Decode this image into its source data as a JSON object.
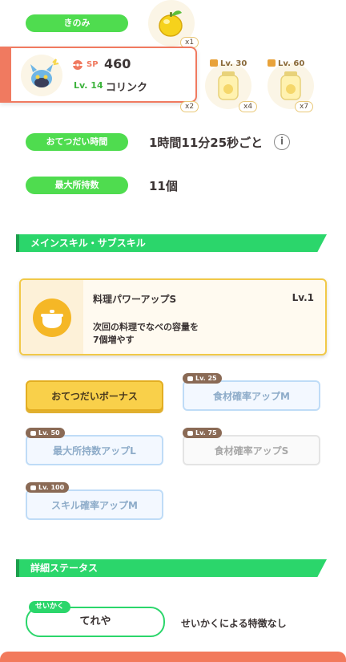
{
  "berry": {
    "label": "きのみ",
    "icon": "lemon-berry-icon",
    "qty": "x1"
  },
  "pokemon": {
    "sp_label": "SP",
    "sp_value": "460",
    "level": "Lv. 14",
    "name": "コリンク",
    "qty": "x2"
  },
  "ingredients": [
    {
      "level": "Lv. 30",
      "qty": "x4",
      "icon": "honey-jar-icon"
    },
    {
      "level": "Lv. 60",
      "qty": "x7",
      "icon": "honey-jar-icon"
    }
  ],
  "help_time": {
    "label": "おてつだい時間",
    "value": "1時間11分25秒ごと"
  },
  "max_carry": {
    "label": "最大所持数",
    "value": "11個"
  },
  "skills_section": {
    "title": "メインスキル・サブスキル"
  },
  "main_skill": {
    "name": "料理パワーアップS",
    "level": "Lv.1",
    "desc_line1": "次回の料理でなべの容量を",
    "desc_line2": "7個増やす"
  },
  "sub_skills": [
    {
      "label": "おてつだいボーナス",
      "lock": ""
    },
    {
      "label": "食材確率アップM",
      "lock": "Lv. 25"
    },
    {
      "label": "最大所持数アップL",
      "lock": "Lv. 50"
    },
    {
      "label": "食材確率アップS",
      "lock": "Lv. 75"
    },
    {
      "label": "スキル確率アップM",
      "lock": "Lv. 100"
    }
  ],
  "detail_section": {
    "title": "詳細ステータス"
  },
  "nature": {
    "tag": "せいかく",
    "name": "てれや",
    "effect": "せいかくによる特徴なし"
  },
  "colors": {
    "green_pill": "#4fdc4f",
    "section_green": "#2bd66b",
    "accent_red": "#f07a60",
    "gold": "#f9d04a"
  }
}
